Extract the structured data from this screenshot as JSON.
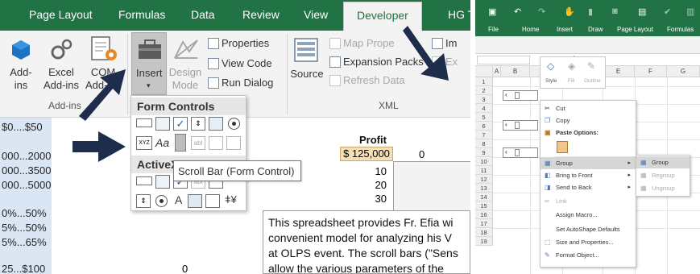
{
  "left": {
    "tabs": [
      {
        "label": "Page Layout",
        "active": false
      },
      {
        "label": "Formulas",
        "active": false
      },
      {
        "label": "Data",
        "active": false
      },
      {
        "label": "Review",
        "active": false
      },
      {
        "label": "View",
        "active": false
      },
      {
        "label": "Developer",
        "active": true
      },
      {
        "label": "HG T",
        "active": false
      }
    ],
    "ribbon": {
      "addins": {
        "label": "Add-\nins"
      },
      "excel_addins": {
        "label": "Excel\nAdd-ins"
      },
      "com_addins": {
        "label": "COM\nAdd-ins"
      },
      "addins_group": "Add-ins",
      "insert": {
        "label": "Insert"
      },
      "design_mode": {
        "label": "Design\nMode"
      },
      "properties": "Properties",
      "view_code": "View Code",
      "run_dialog": "Run Dialog",
      "source": "Source",
      "map_properties": "Map Prope",
      "expansion_packs": "Expansion Packs",
      "refresh_data": "Refresh Data",
      "xml_group": "XML",
      "import": "Im",
      "export": "Ex"
    },
    "column_a": [
      "$0....$50",
      "000...2000",
      "000...3500",
      "000...5000",
      "0%...50%",
      "5%...50%",
      "5%...65%",
      "25...$100"
    ],
    "profit_header": "Profit",
    "profit_value": "$ 125,000",
    "profit_zero": "0",
    "numbers": [
      "10",
      "20",
      "30"
    ],
    "bottom_zero": "0",
    "textbox_lines": [
      "This spreadsheet provides Fr. Efia wi",
      "convenient model for analyzing his V",
      "at OLPS event.  The scroll bars (\"Sens",
      "allow the various parameters of the"
    ],
    "form_controls": {
      "header": "Form Controls",
      "activex_header": "ActiveX",
      "tooltip": "Scroll Bar (Form Control)",
      "glyph_xyz": "XYZ",
      "glyph_aa": "Aa",
      "glyph_a": "A"
    }
  },
  "right": {
    "tabs": [
      "File",
      "Home",
      "Insert",
      "Draw",
      "Page Layout",
      "Formulas"
    ],
    "columns": [
      "A",
      "B",
      "C",
      "D",
      "E",
      "F",
      "G"
    ],
    "rows": [
      "1",
      "2",
      "3",
      "4",
      "5",
      "6",
      "7",
      "8",
      "9",
      "10",
      "11",
      "12",
      "13",
      "14",
      "15",
      "16",
      "17",
      "18",
      "19"
    ],
    "fx_label": "fx",
    "style_labels": [
      "Style",
      "Fill",
      "Outline"
    ],
    "context_menu": [
      {
        "label": "Cut",
        "disabled": false
      },
      {
        "label": "Copy",
        "disabled": false
      },
      {
        "label": "Paste Options:",
        "disabled": false,
        "bold": true
      },
      {
        "label": "",
        "disabled": false
      },
      {
        "label": "Group",
        "disabled": false,
        "highlight": true,
        "submenu": true
      },
      {
        "label": "Bring to Front",
        "disabled": false,
        "submenu": true
      },
      {
        "label": "Send to Back",
        "disabled": false,
        "submenu": true
      },
      {
        "label": "Link",
        "disabled": true
      },
      {
        "label": "Assign Macro...",
        "disabled": false
      },
      {
        "label": "Set AutoShape Defaults",
        "disabled": false
      },
      {
        "label": "Size and Properties...",
        "disabled": false
      },
      {
        "label": "Format Object...",
        "disabled": false
      }
    ],
    "submenu": [
      {
        "label": "Group",
        "disabled": false,
        "highlight": true
      },
      {
        "label": "Regroup",
        "disabled": true
      },
      {
        "label": "Ungroup",
        "disabled": true
      }
    ]
  },
  "colors": {
    "excel_green": "#217346",
    "arrow_navy": "#1f2d4d",
    "profit_fill": "#f6dfb7",
    "column_a_fill": "#dbe6f4"
  }
}
